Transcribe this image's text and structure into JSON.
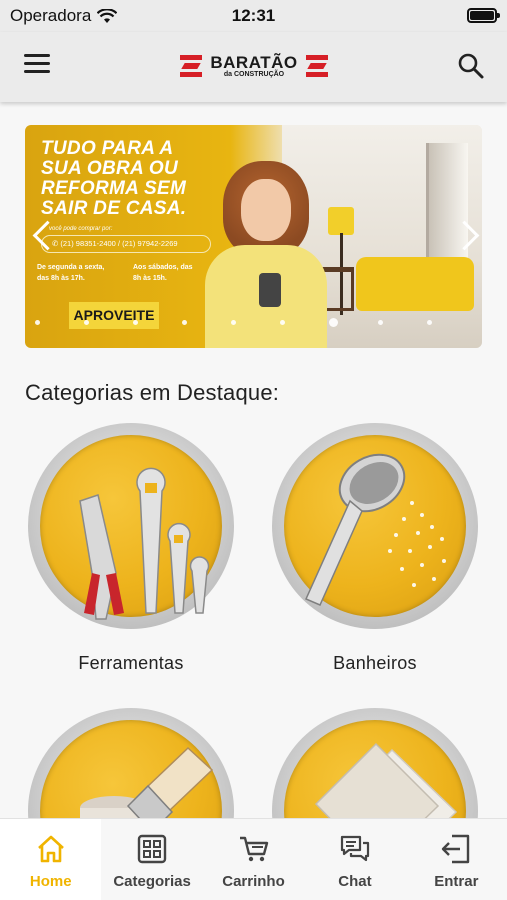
{
  "status_bar": {
    "carrier": "Operadora",
    "time": "12:31"
  },
  "header": {
    "logo_title": "BARATÃO",
    "logo_subtitle": "da CONSTRUÇÃO"
  },
  "banner": {
    "headline": "TUDO PARA A SUA OBRA OU REFORMA SEM SAIR DE CASA.",
    "buy_hint": "você pode comprar por:",
    "phones": "(21) 98351-2400 / (21) 97942-2269",
    "hours_weekdays": "De segunda a sexta, das 8h às 17h.",
    "hours_saturday": "Aos sábados, das 8h às 15h.",
    "cta": "APROVEITE",
    "slide_count": 9,
    "active_slide": 6
  },
  "section_title": "Categorias em Destaque:",
  "categories": [
    {
      "label": "Ferramentas",
      "icon": "tools-icon"
    },
    {
      "label": "Banheiros",
      "icon": "shower-icon"
    },
    {
      "label": "",
      "icon": "paint-brush-icon"
    },
    {
      "label": "",
      "icon": "tiles-icon"
    }
  ],
  "tabs": [
    {
      "label": "Home",
      "icon": "home-icon",
      "active": true
    },
    {
      "label": "Categorias",
      "icon": "grid-icon",
      "active": false
    },
    {
      "label": "Carrinho",
      "icon": "cart-icon",
      "active": false
    },
    {
      "label": "Chat",
      "icon": "chat-icon",
      "active": false
    },
    {
      "label": "Entrar",
      "icon": "login-icon",
      "active": false
    }
  ],
  "colors": {
    "accent": "#f0b400",
    "brand_red": "#d61f26",
    "banner_yellow": "#e8b511"
  }
}
